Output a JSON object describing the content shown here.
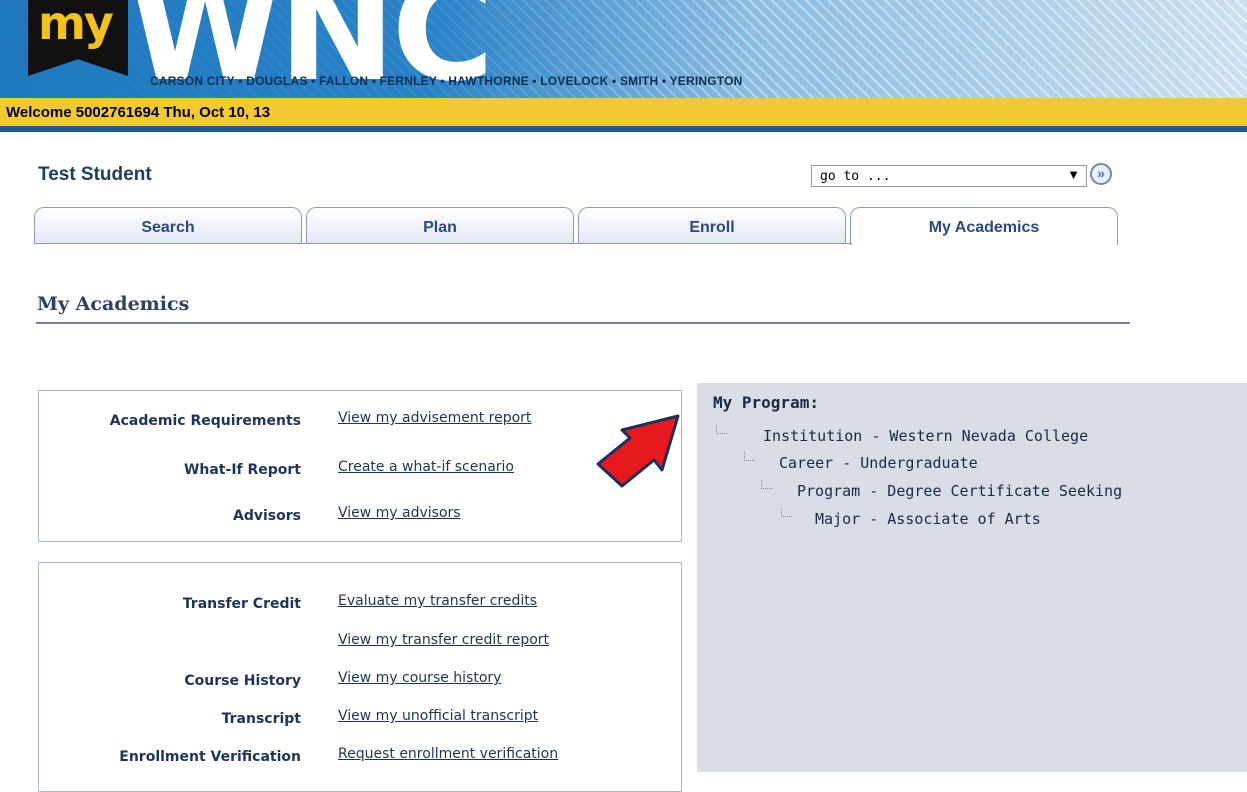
{
  "banner": {
    "logo_my": "my",
    "logo_wnc": "WNC",
    "locations": "CARSON CITY • DOUGLAS • FALLON • FERNLEY • HAWTHORNE • LOVELOCK • SMITH • YERINGTON"
  },
  "welcome": "Welcome 5002761694 Thu, Oct 10, 13",
  "student_name": "Test Student",
  "goto": {
    "value": "go to ...",
    "arrow": "▼",
    "button": "»"
  },
  "tabs": [
    {
      "label": "Search"
    },
    {
      "label": "Plan"
    },
    {
      "label": "Enroll"
    },
    {
      "label": "My Academics"
    }
  ],
  "page_title": "My Academics",
  "requirements_box": [
    {
      "label": "Academic Requirements",
      "link": "View my advisement report"
    },
    {
      "label": "What-If Report",
      "link": "Create a what-if scenario"
    },
    {
      "label": "Advisors",
      "link": "View my advisors"
    }
  ],
  "records_box": [
    {
      "label": "Transfer Credit",
      "link": "Evaluate my transfer credits"
    },
    {
      "label": "",
      "link": "View my transfer credit report"
    },
    {
      "label": "Course History",
      "link": "View my course history"
    },
    {
      "label": "Transcript",
      "link": "View my unofficial transcript"
    },
    {
      "label": "Enrollment Verification",
      "link": "Request enrollment verification"
    }
  ],
  "program": {
    "title": "My Program:",
    "items": [
      "Institution - Western Nevada College",
      "Career - Undergraduate",
      "Program - Degree Certificate Seeking",
      "Major - Associate of Arts"
    ]
  },
  "colors": {
    "banner_blue": "#2e83c2",
    "welcome_yellow": "#f2c833",
    "arrow_red": "#e8191c",
    "panel_gray": "#d8dde6"
  }
}
